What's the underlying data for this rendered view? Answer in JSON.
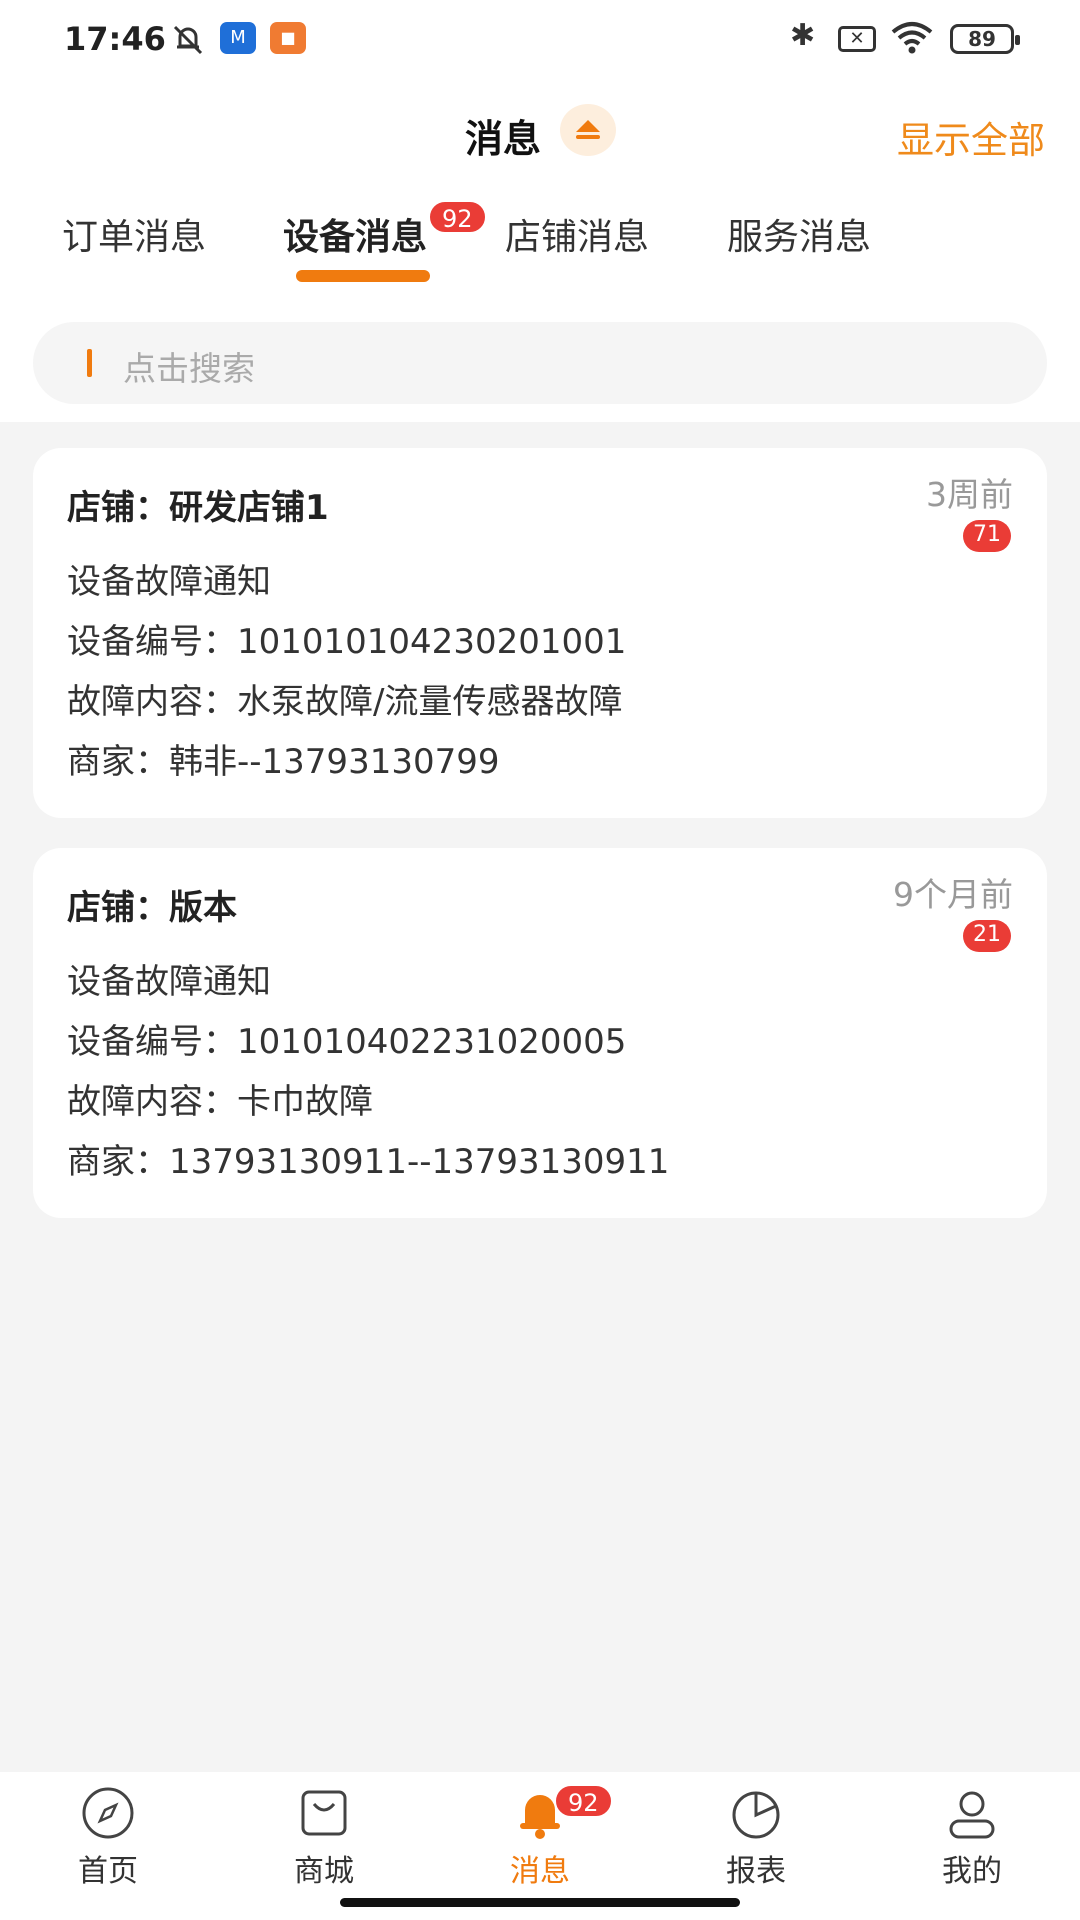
{
  "status_bar": {
    "time": "17:46",
    "app1_label": "M",
    "app2_label": "■",
    "bluetooth_glyph": "✱",
    "x_glyph": "✕",
    "battery": "89"
  },
  "header": {
    "title": "消息",
    "show_all": "显示全部"
  },
  "tabs": [
    {
      "label": "订单消息"
    },
    {
      "label": "设备消息",
      "badge": "92"
    },
    {
      "label": "店铺消息"
    },
    {
      "label": "服务消息"
    }
  ],
  "search": {
    "placeholder": "点击搜索"
  },
  "messages": [
    {
      "shop": "店铺：研发店铺1",
      "time": "3周前",
      "count": "71",
      "title": "设备故障通知",
      "device_no": "设备编号：101010104230201001",
      "fault": "故障内容：水泵故障/流量传感器故障",
      "merchant": "商家：韩非--13793130799"
    },
    {
      "shop": "店铺：版本",
      "time": "9个月前",
      "count": "21",
      "title": "设备故障通知",
      "device_no": "设备编号：101010402231020005",
      "fault": "故障内容：卡巾故障",
      "merchant": "商家：13793130911--13793130911"
    }
  ],
  "bottom_nav": [
    {
      "label": "首页",
      "icon": "compass-icon"
    },
    {
      "label": "商城",
      "icon": "shopping-bag-icon"
    },
    {
      "label": "消息",
      "icon": "bell-icon",
      "badge": "92"
    },
    {
      "label": "报表",
      "icon": "pie-chart-icon"
    },
    {
      "label": "我的",
      "icon": "user-icon"
    }
  ],
  "colors": {
    "accent": "#f07b0f",
    "badge": "#ea3c36",
    "background": "#f4f4f4"
  }
}
